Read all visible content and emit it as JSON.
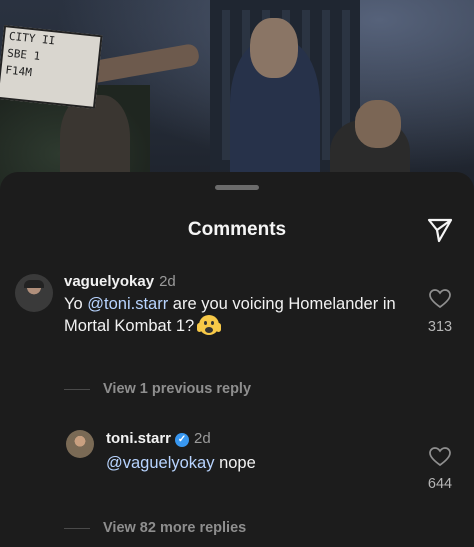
{
  "header": {
    "title": "Comments"
  },
  "photo": {
    "clapper_lines": [
      "CITY II",
      "SBE 1",
      "F14M"
    ]
  },
  "comments": [
    {
      "username": "vaguelyokay",
      "age": "2d",
      "text_before": "Yo ",
      "mention": "@toni.starr",
      "text_after": " are you voicing Homelander in Mortal Kombat 1?",
      "likes": "313",
      "view_replies": "View 1 previous reply"
    },
    {
      "username": "toni.starr",
      "verified": true,
      "age": "2d",
      "mention": "@vaguelyokay",
      "text_after": " nope",
      "likes": "644",
      "view_replies": "View 82 more replies"
    }
  ],
  "colors": {
    "background": "#1c1c1c",
    "mention": "#b8d4ff",
    "verified": "#3897f0",
    "muted": "#8e8e8e"
  }
}
